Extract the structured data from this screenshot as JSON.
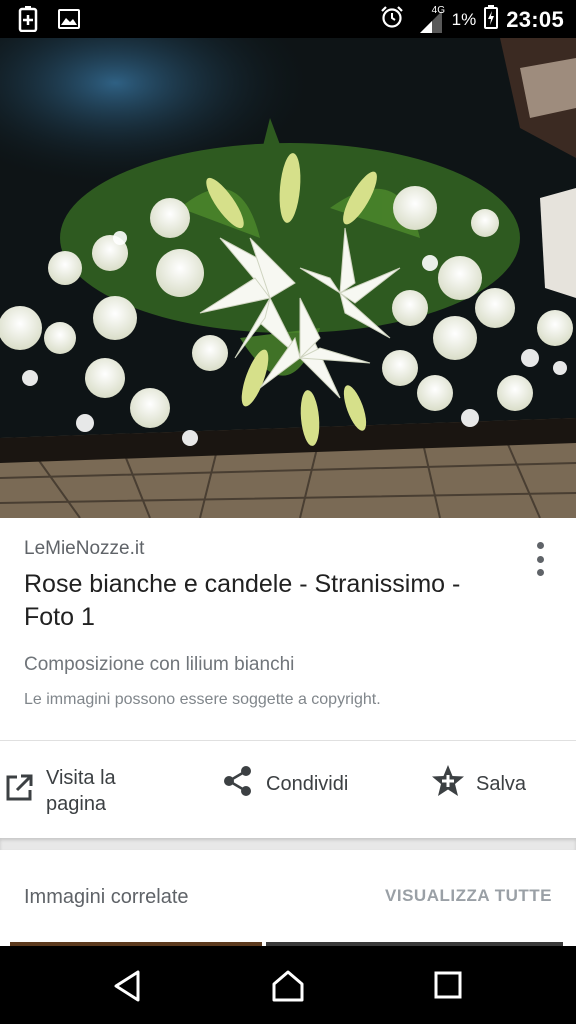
{
  "status_bar": {
    "time": "23:05",
    "battery_percent": "1%",
    "network": "4G",
    "icons": [
      "battery-saver-icon",
      "gallery-icon",
      "alarm-icon",
      "signal-icon",
      "battery-icon"
    ]
  },
  "result": {
    "site": "LeMieNozze.it",
    "title": "Rose bianche e candele - Stranissimo - Foto 1",
    "description": "Composizione con lilium bianchi",
    "copyright_notice": "Le immagini possono essere soggette a copyright."
  },
  "actions": {
    "visit_label": "Visita la pagina",
    "share_label": "Condividi",
    "save_label": "Salva"
  },
  "related": {
    "title": "Immagini correlate",
    "view_all_label": "VISUALIZZA TUTTE"
  },
  "colors": {
    "accent_text": "#212121",
    "secondary_text": "#5f6368",
    "muted_text": "#9aa0a6"
  }
}
